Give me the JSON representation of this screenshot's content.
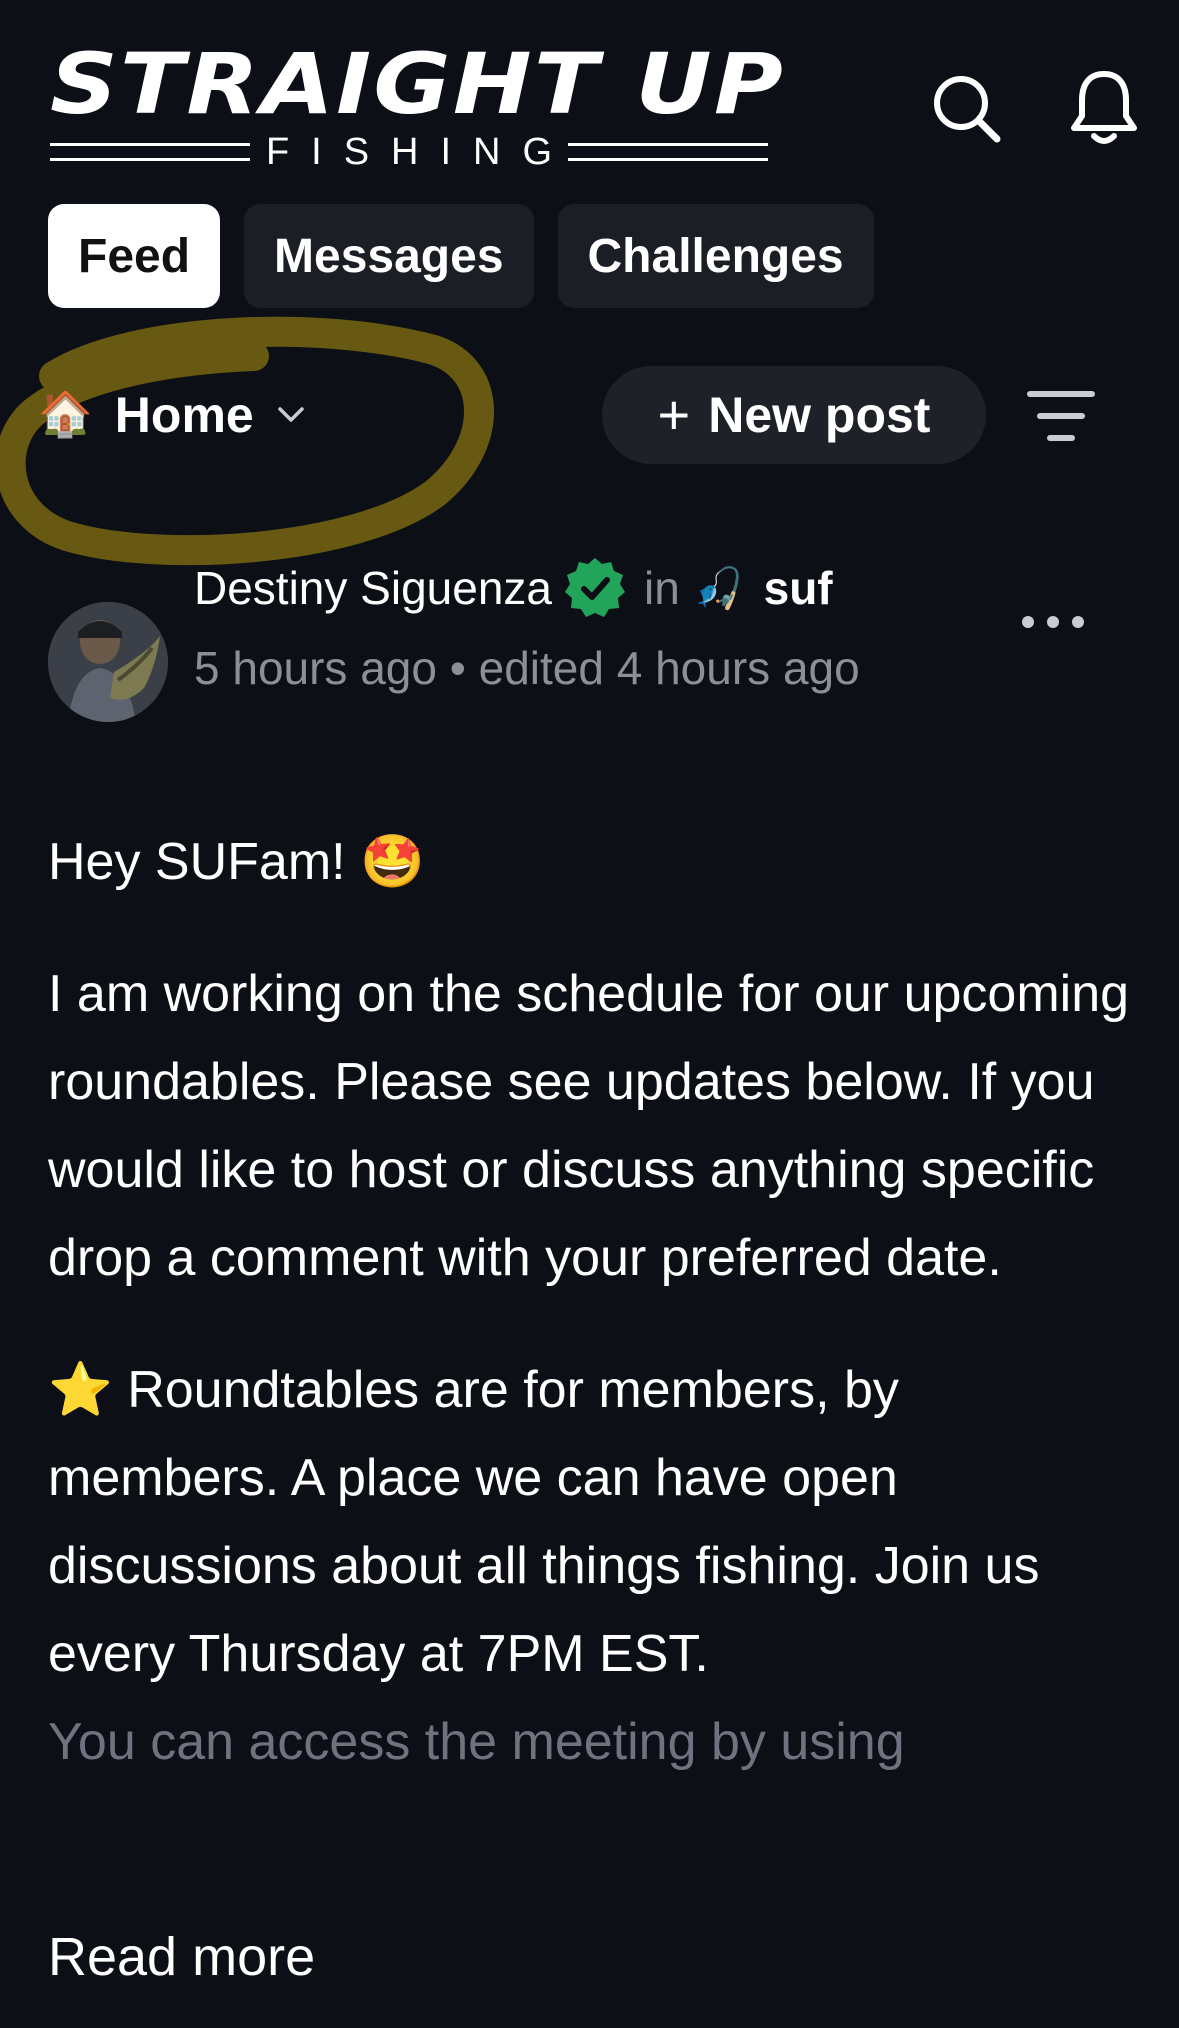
{
  "header": {
    "logo_title": "STRAIGHT UP",
    "logo_subtitle": "FISHING",
    "search_icon": "search-icon",
    "notifications_icon": "bell-icon"
  },
  "tabs": [
    {
      "label": "Feed",
      "active": true
    },
    {
      "label": "Messages",
      "active": false
    },
    {
      "label": "Challenges",
      "active": false
    }
  ],
  "toolbar": {
    "home_emoji": "🏠",
    "home_label": "Home",
    "new_post_plus": "+",
    "new_post_label": "New post",
    "sort_icon": "sort-lines-icon"
  },
  "post": {
    "author": "Destiny Siguenza",
    "verified": true,
    "in_word": "in",
    "space_emoji": "🎣",
    "space_name": "suf",
    "timestamp": "5 hours ago • edited 4 hours ago",
    "greeting": "Hey SUFam! 🤩",
    "paragraph_1": "I am working on the schedule for our upcoming roundables. Please see updates below. If you would like to host or discuss anything specific drop a comment with your preferred date.",
    "paragraph_2": "⭐ Roundtables are for members, by members. A place we can have open discussions about all things fishing. Join us every Thursday at 7PM EST.",
    "faded_line": "You can access the meeting by using",
    "read_more": "Read more"
  },
  "colors": {
    "background": "#0d0f16",
    "muted_text": "#8b8f98",
    "verified_green": "#22a55b",
    "highlight_ring": "#6d5e12"
  }
}
